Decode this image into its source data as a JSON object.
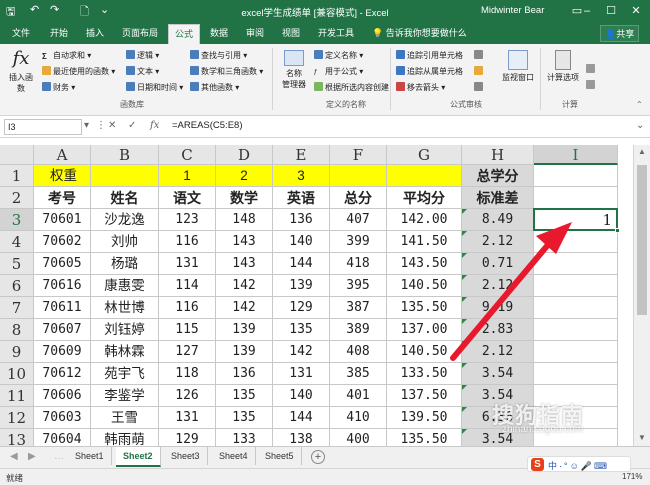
{
  "window": {
    "title": "excel学生成绩单 [兼容模式] - Excel",
    "user": "Midwinter Bear"
  },
  "ribbon_tabs": [
    "文件",
    "开始",
    "插入",
    "页面布局",
    "公式",
    "数据",
    "审阅",
    "视图",
    "开发工具"
  ],
  "active_tab": "公式",
  "tell_me": "告诉我你想要做什么",
  "share": "共享",
  "ribbon": {
    "insert_function": "插入函数",
    "autosum": "自动求和",
    "recent": "最近使用的函数",
    "finance": "财务",
    "logical": "逻辑",
    "text": "文本",
    "datetime": "日期和时间",
    "lookup": "查找与引用",
    "math": "数学和三角函数",
    "other": "其他函数",
    "group_library": "函数库",
    "name_manager_1": "名称",
    "name_manager_2": "管理器",
    "define_name": "定义名称",
    "use_in_formula": "用于公式",
    "create_from_selection": "根据所选内容创建",
    "group_names": "定义的名称",
    "trace_precedents": "追踪引用单元格",
    "trace_dependents": "追踪从属单元格",
    "remove_arrows": "移去箭头",
    "group_audit": "公式审核",
    "watch_window": "监视窗口",
    "calc_options": "计算选项",
    "group_calc": "计算"
  },
  "formula_bar": {
    "name_box": "I3",
    "formula": "=AREAS(C5:E8)"
  },
  "columns": [
    "A",
    "B",
    "C",
    "D",
    "E",
    "F",
    "G",
    "H",
    "I"
  ],
  "selected_column": "I",
  "selected_row": "3",
  "rows": [
    {
      "n": "1",
      "cells": [
        "权重",
        "",
        "1",
        "2",
        "3",
        "",
        "",
        "总学分",
        ""
      ]
    },
    {
      "n": "2",
      "cells": [
        "考号",
        "姓名",
        "语文",
        "数学",
        "英语",
        "总分",
        "平均分",
        "标准差",
        ""
      ]
    },
    {
      "n": "3",
      "cells": [
        "70601",
        "沙龙逸",
        "123",
        "148",
        "136",
        "407",
        "142.00",
        "8.49",
        "1"
      ]
    },
    {
      "n": "4",
      "cells": [
        "70602",
        "刘帅",
        "116",
        "143",
        "140",
        "399",
        "141.50",
        "2.12",
        ""
      ]
    },
    {
      "n": "5",
      "cells": [
        "70605",
        "杨璐",
        "131",
        "143",
        "144",
        "418",
        "143.50",
        "0.71",
        ""
      ]
    },
    {
      "n": "6",
      "cells": [
        "70616",
        "康惠雯",
        "114",
        "142",
        "139",
        "395",
        "140.50",
        "2.12",
        ""
      ]
    },
    {
      "n": "7",
      "cells": [
        "70611",
        "林世博",
        "116",
        "142",
        "129",
        "387",
        "135.50",
        "9.19",
        ""
      ]
    },
    {
      "n": "8",
      "cells": [
        "70607",
        "刘钰婷",
        "115",
        "139",
        "135",
        "389",
        "137.00",
        "2.83",
        ""
      ]
    },
    {
      "n": "9",
      "cells": [
        "70609",
        "韩林霖",
        "127",
        "139",
        "142",
        "408",
        "140.50",
        "2.12",
        ""
      ]
    },
    {
      "n": "10",
      "cells": [
        "70612",
        "苑宇飞",
        "118",
        "136",
        "131",
        "385",
        "133.50",
        "3.54",
        ""
      ]
    },
    {
      "n": "11",
      "cells": [
        "70606",
        "李鉴学",
        "126",
        "135",
        "140",
        "401",
        "137.50",
        "3.54",
        ""
      ]
    },
    {
      "n": "12",
      "cells": [
        "70603",
        "王雪",
        "131",
        "135",
        "144",
        "410",
        "139.50",
        "6.36",
        ""
      ]
    },
    {
      "n": "13",
      "cells": [
        "70604",
        "韩雨萌",
        "129",
        "133",
        "138",
        "400",
        "135.50",
        "3.54",
        ""
      ]
    }
  ],
  "sheets": [
    "Sheet1",
    "Sheet2",
    "Sheet3",
    "Sheet4",
    "Sheet5"
  ],
  "active_sheet": "Sheet2",
  "status": "就绪",
  "zoom": "171%",
  "watermark": "搜狗指南",
  "watermark_url": "zhinan.sogou.com",
  "ime_text": "中·°☺🎤⌨",
  "colors": {
    "excel_green": "#217346",
    "header_highlight": "#ffff00",
    "column_h_fill": "#d9d9d9",
    "arrow": "#e8192c"
  }
}
